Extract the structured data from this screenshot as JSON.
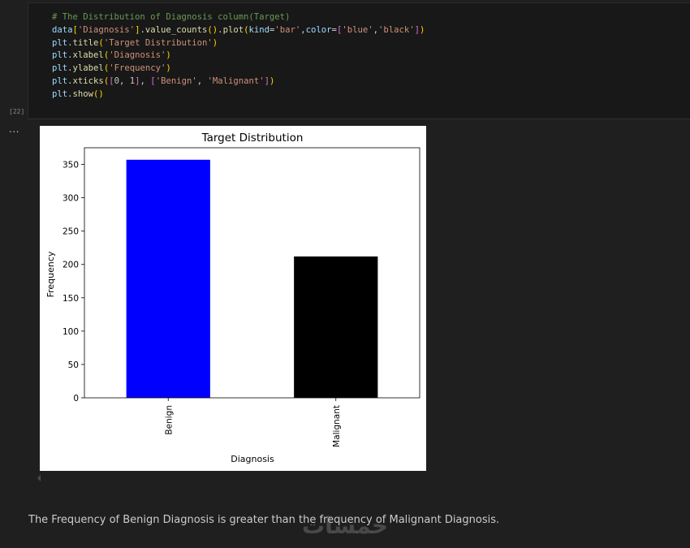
{
  "code_cell": {
    "lines": [
      [
        {
          "t": "# The Distribution of Diagnosis column(Target)",
          "c": "#6a9955"
        }
      ],
      [
        {
          "t": "data",
          "c": "#9cdcfe"
        },
        {
          "t": "[",
          "c": "#ffd700"
        },
        {
          "t": "'Diagnosis'",
          "c": "#ce9178"
        },
        {
          "t": "]",
          "c": "#ffd700"
        },
        {
          "t": ".",
          "c": "#d4d4d4"
        },
        {
          "t": "value_counts",
          "c": "#dcdcaa"
        },
        {
          "t": "()",
          "c": "#ffd700"
        },
        {
          "t": ".",
          "c": "#d4d4d4"
        },
        {
          "t": "plot",
          "c": "#dcdcaa"
        },
        {
          "t": "(",
          "c": "#ffd700"
        },
        {
          "t": "kind",
          "c": "#9cdcfe"
        },
        {
          "t": "=",
          "c": "#d4d4d4"
        },
        {
          "t": "'bar'",
          "c": "#ce9178"
        },
        {
          "t": ",",
          "c": "#d4d4d4"
        },
        {
          "t": "color",
          "c": "#9cdcfe"
        },
        {
          "t": "=",
          "c": "#d4d4d4"
        },
        {
          "t": "[",
          "c": "#da70d6"
        },
        {
          "t": "'blue'",
          "c": "#ce9178"
        },
        {
          "t": ",",
          "c": "#d4d4d4"
        },
        {
          "t": "'black'",
          "c": "#ce9178"
        },
        {
          "t": "]",
          "c": "#da70d6"
        },
        {
          "t": ")",
          "c": "#ffd700"
        }
      ],
      [
        {
          "t": "plt",
          "c": "#9cdcfe"
        },
        {
          "t": ".",
          "c": "#d4d4d4"
        },
        {
          "t": "title",
          "c": "#dcdcaa"
        },
        {
          "t": "(",
          "c": "#ffd700"
        },
        {
          "t": "'Target Distribution'",
          "c": "#ce9178"
        },
        {
          "t": ")",
          "c": "#ffd700"
        }
      ],
      [
        {
          "t": "plt",
          "c": "#9cdcfe"
        },
        {
          "t": ".",
          "c": "#d4d4d4"
        },
        {
          "t": "xlabel",
          "c": "#dcdcaa"
        },
        {
          "t": "(",
          "c": "#ffd700"
        },
        {
          "t": "'Diagnosis'",
          "c": "#ce9178"
        },
        {
          "t": ")",
          "c": "#ffd700"
        }
      ],
      [
        {
          "t": "plt",
          "c": "#9cdcfe"
        },
        {
          "t": ".",
          "c": "#d4d4d4"
        },
        {
          "t": "ylabel",
          "c": "#dcdcaa"
        },
        {
          "t": "(",
          "c": "#ffd700"
        },
        {
          "t": "'Frequency'",
          "c": "#ce9178"
        },
        {
          "t": ")",
          "c": "#ffd700"
        }
      ],
      [
        {
          "t": "plt",
          "c": "#9cdcfe"
        },
        {
          "t": ".",
          "c": "#d4d4d4"
        },
        {
          "t": "xticks",
          "c": "#dcdcaa"
        },
        {
          "t": "(",
          "c": "#ffd700"
        },
        {
          "t": "[",
          "c": "#da70d6"
        },
        {
          "t": "0",
          "c": "#b5cea8"
        },
        {
          "t": ", ",
          "c": "#d4d4d4"
        },
        {
          "t": "1",
          "c": "#b5cea8"
        },
        {
          "t": "]",
          "c": "#da70d6"
        },
        {
          "t": ", ",
          "c": "#d4d4d4"
        },
        {
          "t": "[",
          "c": "#da70d6"
        },
        {
          "t": "'Benign'",
          "c": "#ce9178"
        },
        {
          "t": ", ",
          "c": "#d4d4d4"
        },
        {
          "t": "'Malignant'",
          "c": "#ce9178"
        },
        {
          "t": "]",
          "c": "#da70d6"
        },
        {
          "t": ")",
          "c": "#ffd700"
        }
      ],
      [
        {
          "t": "plt",
          "c": "#9cdcfe"
        },
        {
          "t": ".",
          "c": "#d4d4d4"
        },
        {
          "t": "show",
          "c": "#dcdcaa"
        },
        {
          "t": "()",
          "c": "#ffd700"
        }
      ]
    ],
    "execution_count": "[22]"
  },
  "output": {
    "ellipsis": "..."
  },
  "chart_data": {
    "type": "bar",
    "title": "Target Distribution",
    "xlabel": "Diagnosis",
    "ylabel": "Frequency",
    "categories": [
      "Benign",
      "Malignant"
    ],
    "values": [
      357,
      212
    ],
    "colors": [
      "#0000ff",
      "#000000"
    ],
    "ylim": [
      0,
      375
    ],
    "yticks": [
      0,
      50,
      100,
      150,
      200,
      250,
      300,
      350
    ],
    "grid": false,
    "legend": "none"
  },
  "markdown": {
    "text": "The Frequency of Benign Diagnosis is greater than the frequency of Malignant Diagnosis."
  },
  "watermark": {
    "text": "خمسات"
  }
}
